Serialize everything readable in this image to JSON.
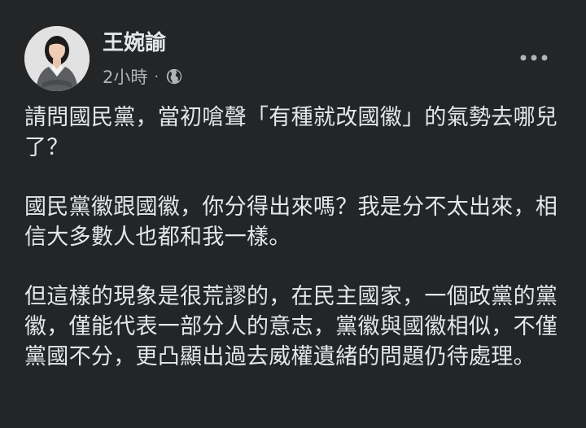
{
  "post": {
    "author_name": "王婉諭",
    "timestamp": "2小時",
    "separator": "·",
    "privacy_icon": "globe-icon",
    "more_icon": "more-options-icon",
    "paragraphs": [
      "請問國民黨，當初嗆聲「有種就改國徽」的氣勢去哪兒了？",
      "國民黨徽跟國徽，你分得出來嗎？我是分不太出來，相信大多數人也都和我一樣。",
      "但這樣的現象是很荒謬的，在民主國家，一個政黨的黨徽，僅能代表一部分人的意志，黨徽與國徽相似，不僅黨國不分，更凸顯出過去威權遺緒的問題仍待處理。"
    ]
  },
  "colors": {
    "background": "#242526",
    "primary_text": "#e4e6eb",
    "secondary_text": "#b0b3b8"
  }
}
